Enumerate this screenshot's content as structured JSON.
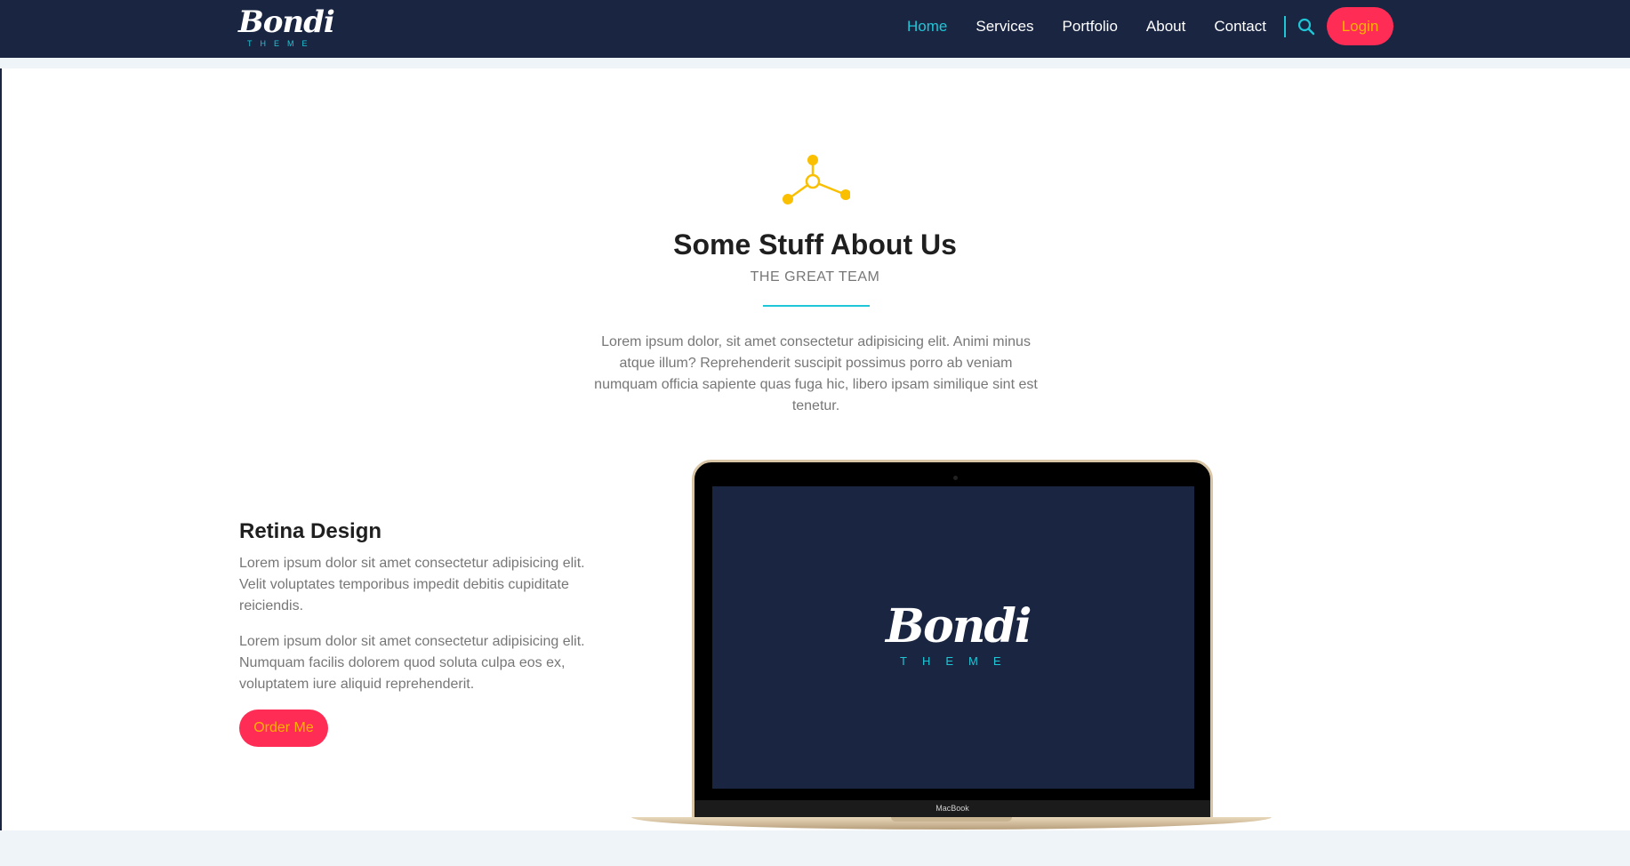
{
  "brand": {
    "logo_script": "Bondi",
    "logo_sub": "THEME"
  },
  "nav": {
    "items": [
      {
        "label": "Home",
        "active": true
      },
      {
        "label": "Services",
        "active": false
      },
      {
        "label": "Portfolio",
        "active": false
      },
      {
        "label": "About",
        "active": false
      },
      {
        "label": "Contact",
        "active": false
      }
    ],
    "search_icon": "search-icon",
    "login_label": "Login"
  },
  "about": {
    "icon": "molecule-icon",
    "title": "Some Stuff About Us",
    "subtitle": "THE GREAT TEAM",
    "intro": "Lorem ipsum dolor, sit amet consectetur adipisicing elit. Animi minus atque illum? Reprehenderit suscipit possimus porro ab veniam numquam officia sapiente quas fuga hic, libero ipsam similique sint est tenetur."
  },
  "feature": {
    "title": "Retina Design",
    "p1": "Lorem ipsum dolor sit amet consectetur adipisicing elit. Velit voluptates temporibus impedit debitis cupiditate reiciendis.",
    "p2": "Lorem ipsum dolor sit amet consectetur adipisicing elit. Numquam facilis dolorem quod soluta culpa eos ex, voluptatem iure aliquid reprehenderit.",
    "button_label": "Order Me"
  },
  "laptop": {
    "screen_logo_script": "Bondi",
    "screen_logo_sub": "THEME",
    "brand_label": "MacBook"
  },
  "colors": {
    "navy": "#1a2542",
    "accent_teal": "#1fc6d6",
    "button_bg": "#ff2d55",
    "button_text": "#ffb300",
    "icon_yellow": "#f9bf00"
  }
}
